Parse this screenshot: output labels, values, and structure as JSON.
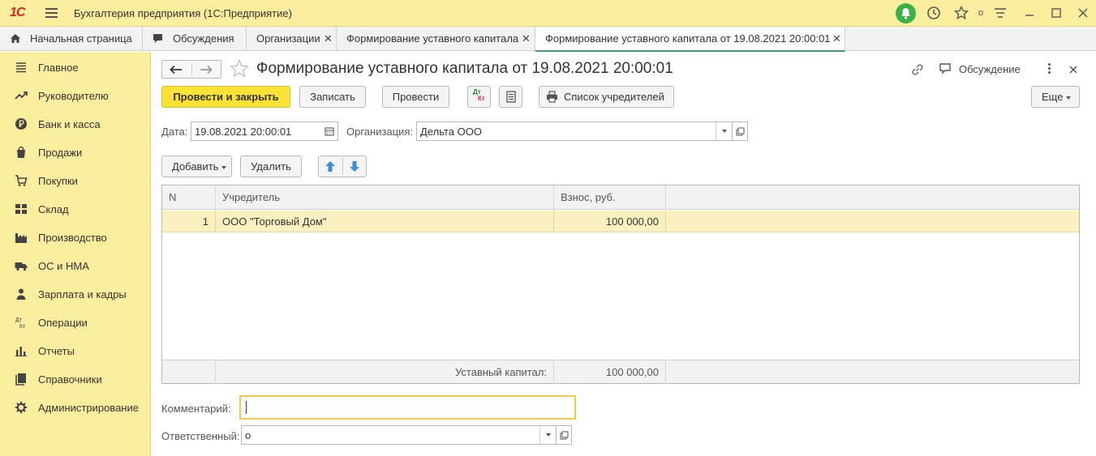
{
  "app": {
    "logo": "1С",
    "title": "Бухгалтерия предприятия  (1С:Предприятие)",
    "favorites_count": "о"
  },
  "tabs": [
    {
      "label": "Начальная страница"
    },
    {
      "label": "Обсуждения"
    },
    {
      "label": "Организации"
    },
    {
      "label": "Формирование уставного капитала"
    },
    {
      "label": "Формирование уставного капитала от 19.08.2021 20:00:01"
    }
  ],
  "sidebar": {
    "items": [
      {
        "label": "Главное",
        "icon": "menu-lines-icon"
      },
      {
        "label": "Руководителю",
        "icon": "trend-icon"
      },
      {
        "label": "Банк и касса",
        "icon": "ruble-coin-icon"
      },
      {
        "label": "Продажи",
        "icon": "shopping-bag-icon"
      },
      {
        "label": "Покупки",
        "icon": "cart-icon"
      },
      {
        "label": "Склад",
        "icon": "warehouse-icon"
      },
      {
        "label": "Производство",
        "icon": "factory-icon"
      },
      {
        "label": "ОС и НМА",
        "icon": "truck-icon"
      },
      {
        "label": "Зарплата и кадры",
        "icon": "person-icon"
      },
      {
        "label": "Операции",
        "icon": "dt-kt-icon"
      },
      {
        "label": "Отчеты",
        "icon": "bar-chart-icon"
      },
      {
        "label": "Справочники",
        "icon": "books-icon"
      },
      {
        "label": "Администрирование",
        "icon": "gear-icon"
      }
    ]
  },
  "doc": {
    "title": "Формирование уставного капитала от 19.08.2021 20:00:01",
    "discussion_label": "Обсуждение"
  },
  "toolbar": {
    "post_close": "Провести и закрыть",
    "save": "Записать",
    "post": "Провести",
    "dtkt_top": "Дт",
    "dtkt_bottom": "Кт",
    "founders_list": "Список учредителей",
    "more": "Еще"
  },
  "form": {
    "date_label": "Дата:",
    "date_value": "19.08.2021 20:00:01",
    "org_label": "Организация:",
    "org_value": "Дельта ООО",
    "comment_label": "Комментарий:",
    "comment_value": "",
    "responsible_label": "Ответственный:",
    "responsible_value": "о"
  },
  "table_toolbar": {
    "add": "Добавить",
    "delete": "Удалить"
  },
  "table": {
    "headers": [
      "N",
      "Учредитель",
      "Взнос, руб.",
      ""
    ],
    "rows": [
      {
        "n": "1",
        "founder": "ООО \"Торговый Дом\"",
        "amount": "100 000,00"
      }
    ],
    "footer_label": "Уставный капитал:",
    "footer_total": "100 000,00"
  }
}
